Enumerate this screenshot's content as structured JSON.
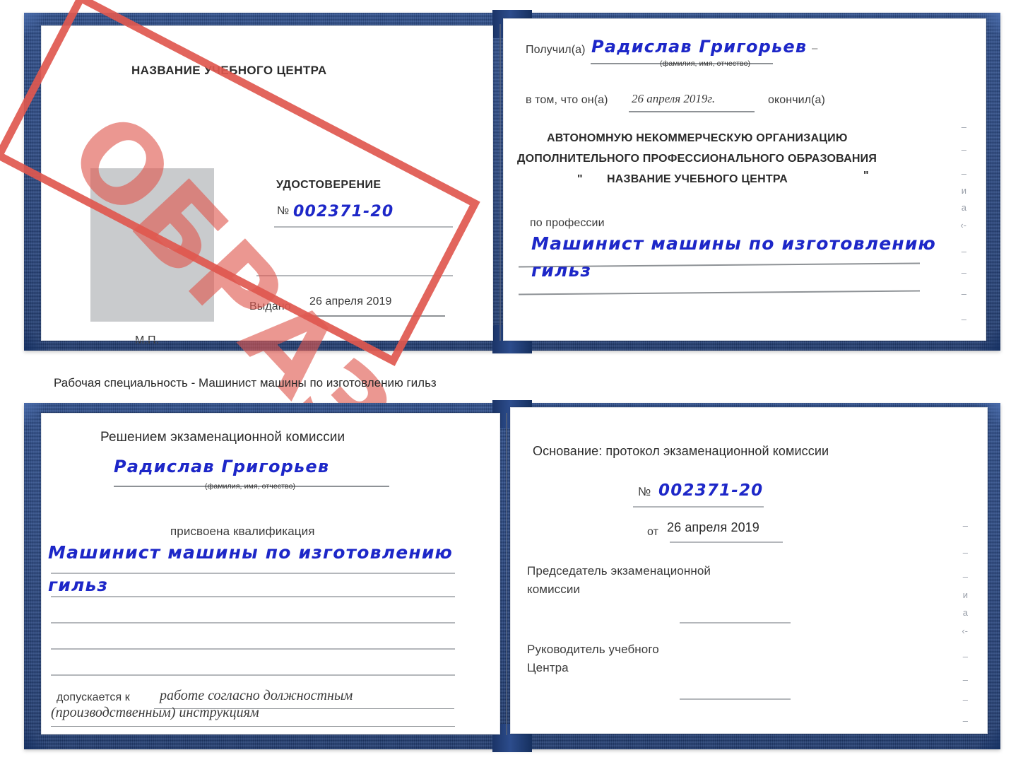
{
  "caption": "Рабочая специальность - Машинист машины по изготовлению гильз",
  "stamp": {
    "text": "ОБРАЗЕЦ",
    "color": "#e0584f"
  },
  "colors": {
    "cover_navy": "#2b4a86",
    "handwriting_blue": "#1d27c8",
    "rule_gray": "#b4b7bb",
    "photo_placeholder": "#c9cbcd"
  },
  "certificate_top": {
    "left_page": {
      "center_name": "НАЗВАНИЕ УЧЕБНОГО ЦЕНТРА",
      "doc_type": "УДОСТОВЕРЕНИЕ",
      "number_label": "№",
      "number_value": "002371-20",
      "issued_label": "Выдано",
      "issued_value": "26 апреля 2019",
      "seal_label": "М.П."
    },
    "right_page": {
      "received_label": "Получил(а)",
      "received_value": "Радислав Григорьев",
      "name_hint": "(фамилия, имя, отчество)",
      "in_that_label": "в том, что он(а)",
      "completion_date": "26 апреля 2019г.",
      "finished_label": "окончил(а)",
      "org_line1": "АВТОНОМНУЮ НЕКОММЕРЧЕСКУЮ ОРГАНИЗАЦИЮ",
      "org_line2": "ДОПОЛНИТЕЛЬНОГО ПРОФЕССИОНАЛЬНОГО ОБРАЗОВАНИЯ",
      "org_quote_open": "\"",
      "org_name": "НАЗВАНИЕ УЧЕБНОГО ЦЕНТРА",
      "org_quote_close": "\"",
      "profession_label": "по профессии",
      "profession_value_line1": "Машинист машины по изготовлению",
      "profession_value_line2": "гильз"
    }
  },
  "certificate_bottom": {
    "left_page": {
      "heading": "Решением экзаменационной комиссии",
      "name_value": "Радислав Григорьев",
      "name_hint": "(фамилия, имя, отчество)",
      "qualification_label": "присвоена квалификация",
      "qualification_line1": "Машинист машины по изготовлению",
      "qualification_line2": "гильз",
      "allowed_label": "допускается к",
      "allowed_value_line1": "работе согласно должностным",
      "allowed_value_line2": "(производственным) инструкциям"
    },
    "right_page": {
      "basis_label": "Основание: протокол экзаменационной комиссии",
      "number_label": "№",
      "number_value": "002371-20",
      "date_label": "от",
      "date_value": "26 апреля 2019",
      "chairman_line1": "Председатель экзаменационной",
      "chairman_line2": "комиссии",
      "head_line1": "Руководитель учебного",
      "head_line2": "Центра"
    }
  },
  "bleed_marks": [
    "–",
    "–",
    "–",
    "и",
    "а",
    "‹-",
    "–",
    "–",
    "–",
    "–"
  ]
}
